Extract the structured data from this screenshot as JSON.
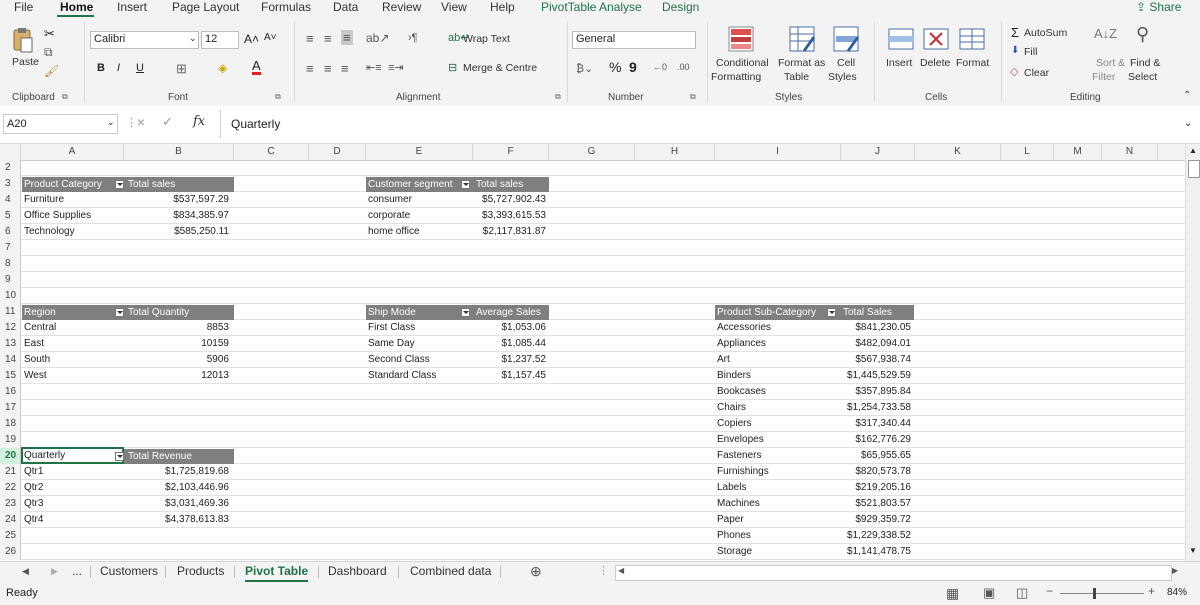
{
  "menu": {
    "tabs": [
      "File",
      "Home",
      "Insert",
      "Page Layout",
      "Formulas",
      "Data",
      "Review",
      "View",
      "Help",
      "PivotTable Analyse",
      "Design"
    ],
    "share": "Share"
  },
  "ribbon": {
    "paste": "Paste",
    "clipboard": "Clipboard",
    "font_name": "Calibri",
    "font_size": "12",
    "font_group": "Font",
    "bold": "B",
    "italic": "I",
    "underline": "U",
    "wrap_text": "Wrap Text",
    "merge_centre": "Merge & Centre",
    "alignment": "Alignment",
    "number_format": "General",
    "percent": "%",
    "comma": "9",
    "number": "Number",
    "cond_format_1": "Conditional",
    "cond_format_2": "Formatting",
    "format_table_1": "Format as",
    "format_table_2": "Table",
    "cell_styles_1": "Cell",
    "cell_styles_2": "Styles",
    "styles": "Styles",
    "insert": "Insert",
    "delete": "Delete",
    "format": "Format",
    "cells": "Cells",
    "autosum": "AutoSum",
    "fill": "Fill",
    "clear": "Clear",
    "sort_filter_1": "Sort &",
    "sort_filter_2": "Filter",
    "find_select_1": "Find &",
    "find_select_2": "Select",
    "editing": "Editing"
  },
  "formula_bar": {
    "name_box": "A20",
    "fx": "fx",
    "content": "Quarterly"
  },
  "columns": [
    "A",
    "B",
    "C",
    "D",
    "E",
    "F",
    "G",
    "H",
    "I",
    "J",
    "K",
    "L",
    "M",
    "N"
  ],
  "rows": [
    "2",
    "3",
    "4",
    "5",
    "6",
    "7",
    "8",
    "9",
    "10",
    "11",
    "12",
    "13",
    "14",
    "15",
    "16",
    "17",
    "18",
    "19",
    "20",
    "21",
    "22",
    "23",
    "24",
    "25",
    "26"
  ],
  "pivots": {
    "category": {
      "h1": "Product Category",
      "h2": "Total sales",
      "rows": [
        [
          "Furniture",
          "$537,597.29"
        ],
        [
          "Office Supplies",
          "$834,385.97"
        ],
        [
          "Technology",
          "$585,250.11"
        ]
      ]
    },
    "segment": {
      "h1": "Customer segment",
      "h2": "Total sales",
      "rows": [
        [
          "consumer",
          "$5,727,902.43"
        ],
        [
          "corporate",
          "$3,393,615.53"
        ],
        [
          "home office",
          "$2,117,831.87"
        ]
      ]
    },
    "region": {
      "h1": "Region",
      "h2": "Total Quantity",
      "rows": [
        [
          "Central",
          "8853"
        ],
        [
          "East",
          "10159"
        ],
        [
          "South",
          "5906"
        ],
        [
          "West",
          "12013"
        ]
      ]
    },
    "shipmode": {
      "h1": "Ship Mode",
      "h2": "Average Sales",
      "rows": [
        [
          "First Class",
          "$1,053.06"
        ],
        [
          "Same Day",
          "$1,085.44"
        ],
        [
          "Second Class",
          "$1,237.52"
        ],
        [
          "Standard Class",
          "$1,157.45"
        ]
      ]
    },
    "subcat": {
      "h1": "Product Sub-Category",
      "h2": "Total Sales",
      "rows": [
        [
          "Accessories",
          "$841,230.05"
        ],
        [
          "Appliances",
          "$482,094.01"
        ],
        [
          "Art",
          "$567,938.74"
        ],
        [
          "Binders",
          "$1,445,529.59"
        ],
        [
          "Bookcases",
          "$357,895.84"
        ],
        [
          "Chairs",
          "$1,254,733.58"
        ],
        [
          "Copiers",
          "$317,340.44"
        ],
        [
          "Envelopes",
          "$162,776.29"
        ],
        [
          "Fasteners",
          "$65,955.65"
        ],
        [
          "Furnishings",
          "$820,573.78"
        ],
        [
          "Labels",
          "$219,205.16"
        ],
        [
          "Machines",
          "$521,803.57"
        ],
        [
          "Paper",
          "$929,359.72"
        ],
        [
          "Phones",
          "$1,229,338.52"
        ],
        [
          "Storage",
          "$1,141,478.75"
        ]
      ]
    },
    "quarterly": {
      "h1": "Quarterly",
      "h2": "Total Revenue",
      "rows": [
        [
          "Qtr1",
          "$1,725,819.68"
        ],
        [
          "Qtr2",
          "$2,103,446.96"
        ],
        [
          "Qtr3",
          "$3,031,469.36"
        ],
        [
          "Qtr4",
          "$4,378,613.83"
        ]
      ]
    }
  },
  "sheet_tabs": {
    "more": "...",
    "tabs": [
      "Customers",
      "Products",
      "Pivot Table",
      "Dashboard",
      "Combined data"
    ],
    "active": "Pivot Table"
  },
  "status": {
    "ready": "Ready",
    "zoom": "84%"
  },
  "colors": {
    "accent": "#217346",
    "pivot_header": "#7f7f7f"
  }
}
